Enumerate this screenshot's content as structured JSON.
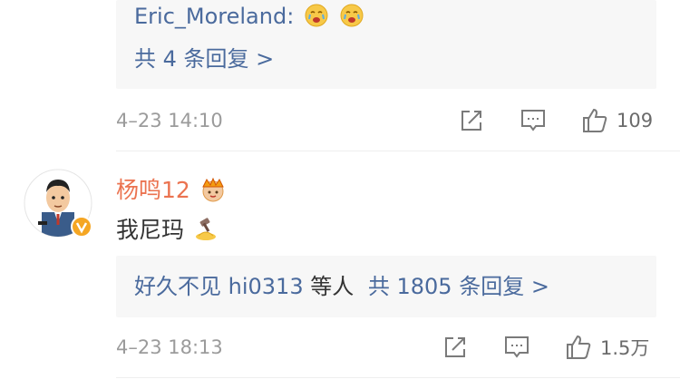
{
  "comment1": {
    "reply_preview": {
      "author": "Eric_Moreland:",
      "emojis": [
        "crying-face-icon",
        "crying-face-icon"
      ],
      "more_replies": "共 4 条回复 >"
    },
    "timestamp": "4–23 14:10",
    "actions": {
      "share_icon": "share-icon",
      "comment_icon": "comment-icon",
      "like_icon": "like-icon",
      "like_count": "109"
    }
  },
  "comment2": {
    "avatar_icon": "avatar-cartoon-man-icon",
    "verified_icon": "verified-badge-icon",
    "username": "杨鸣12",
    "crown_icon": "crown-badge-icon",
    "content": "我尼玛",
    "content_emoji": "gavel-emoji-icon",
    "replies": {
      "users": "好久不见 hi0313",
      "etc": "等人",
      "total": "共 1805 条回复 >"
    },
    "timestamp": "4–23 18:13",
    "actions": {
      "share_icon": "share-icon",
      "comment_icon": "comment-icon",
      "like_icon": "like-icon",
      "like_count": "1.5万"
    }
  },
  "colors": {
    "link_blue": "#4a6a9d",
    "username_orange": "#eb7350",
    "meta_gray": "#9b9b9b",
    "reply_bg": "#f7f7f7",
    "verified_yellow": "#f5a623"
  }
}
